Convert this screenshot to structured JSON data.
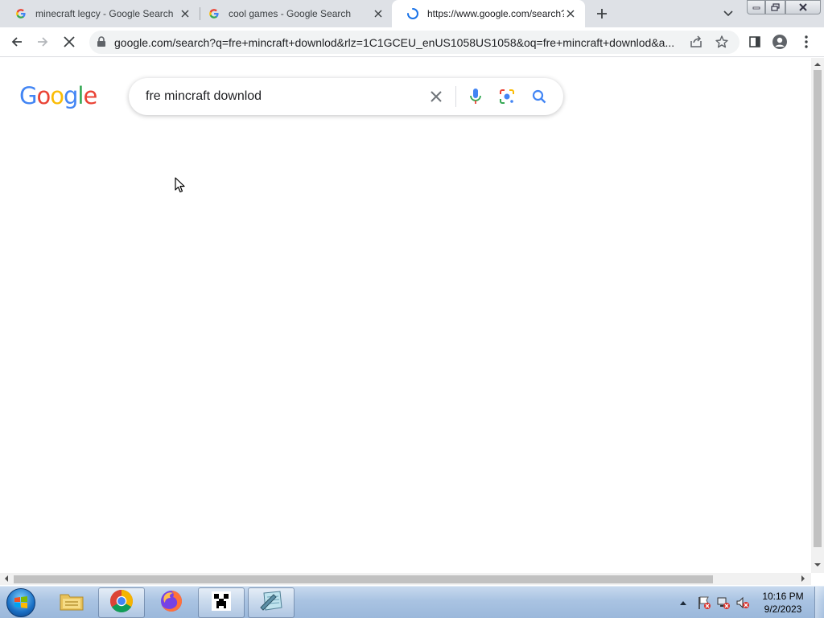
{
  "browser": {
    "tabs": [
      {
        "title": "minecraft legcy - Google Search",
        "favicon": "google-g-icon",
        "active": false
      },
      {
        "title": "cool games - Google Search",
        "favicon": "google-g-icon",
        "active": false
      },
      {
        "title": "https://www.google.com/search?",
        "favicon": "loading-spinner-icon",
        "active": true
      }
    ],
    "url": "google.com/search?q=fre+mincraft+downlod&rlz=1C1GCEU_enUS1058US1058&oq=fre+mincraft+downlod&a...",
    "accent_color": "#1a73e8"
  },
  "page": {
    "logo_text": "Google",
    "logo_letters": [
      {
        "ch": "G",
        "color": "#4285f4"
      },
      {
        "ch": "o",
        "color": "#ea4335"
      },
      {
        "ch": "o",
        "color": "#fbbc05"
      },
      {
        "ch": "g",
        "color": "#4285f4"
      },
      {
        "ch": "l",
        "color": "#34a853"
      },
      {
        "ch": "e",
        "color": "#ea4335"
      }
    ],
    "search_query": "fre mincraft downlod"
  },
  "taskbar": {
    "apps": [
      "windows-explorer-icon",
      "chrome-icon",
      "firefox-icon",
      "minecraft-icon",
      "notepad-icon"
    ],
    "clock_time": "10:16 PM",
    "clock_date": "9/2/2023"
  }
}
